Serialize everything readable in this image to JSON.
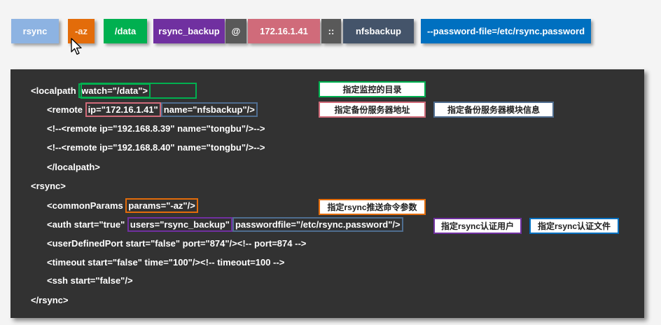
{
  "command": {
    "parts": [
      {
        "text": "rsync",
        "color": "#8db3e2"
      },
      {
        "text": "-az",
        "color": "#e36c0a"
      },
      {
        "text": "/data",
        "color": "#00b050"
      },
      {
        "text": "rsync_backup",
        "color": "#7030a0"
      },
      {
        "text": "@",
        "color": "#595959"
      },
      {
        "text": "172.16.1.41",
        "color": "#d06b7a"
      },
      {
        "text": "::",
        "color": "#595959"
      },
      {
        "text": "nfsbackup",
        "color": "#44546a"
      },
      {
        "text": "--password-file=/etc/rsync.password",
        "color": "#0070c0"
      }
    ]
  },
  "config": {
    "localpath_open_prefix": "<localpath ",
    "localpath_watch": "watch=\"/data\">",
    "remote_prefix": "<remote ",
    "remote_ip": "ip=\"172.16.1.41\"",
    "remote_name": "name=\"nfsbackup\"/>",
    "comment_remote_1": "<!--<remote ip=\"192.168.8.39\" name=\"tongbu\"/>-->",
    "comment_remote_2": "<!--<remote ip=\"192.168.8.40\" name=\"tongbu\"/>-->",
    "localpath_close": "</localpath>",
    "rsync_open": "<rsync>",
    "common_prefix": "<commonParams ",
    "common_params": "params=\"-az\"/>",
    "auth_prefix": "<auth start=\"true\" ",
    "auth_users": "users=\"rsync_backup\"",
    "auth_passwordfile": "passwordfile=\"/etc/rsync.password\"/>",
    "port_line": "<userDefinedPort start=\"false\" port=\"874\"/><!-- port=874 -->",
    "timeout_line": "<timeout start=\"false\" time=\"100\"/><!-- timeout=100 -->",
    "ssh_line": "<ssh start=\"false\"/>",
    "rsync_close": "</rsync>"
  },
  "annotations": {
    "watch_dir": "指定监控的目录",
    "backup_server_addr": "指定备份服务器地址",
    "backup_module_info": "指定备份服务器模块信息",
    "push_params": "指定rsync推送命令参数",
    "auth_user": "指定rsync认证用户",
    "auth_file": "指定rsync认证文件"
  },
  "colors": {
    "green": "#00b050",
    "pink": "#d06b7a",
    "slate": "#4f6d8f",
    "orange": "#e36c0a",
    "purple": "#7030a0",
    "blue": "#0070c0",
    "panel_bg": "#323232"
  }
}
